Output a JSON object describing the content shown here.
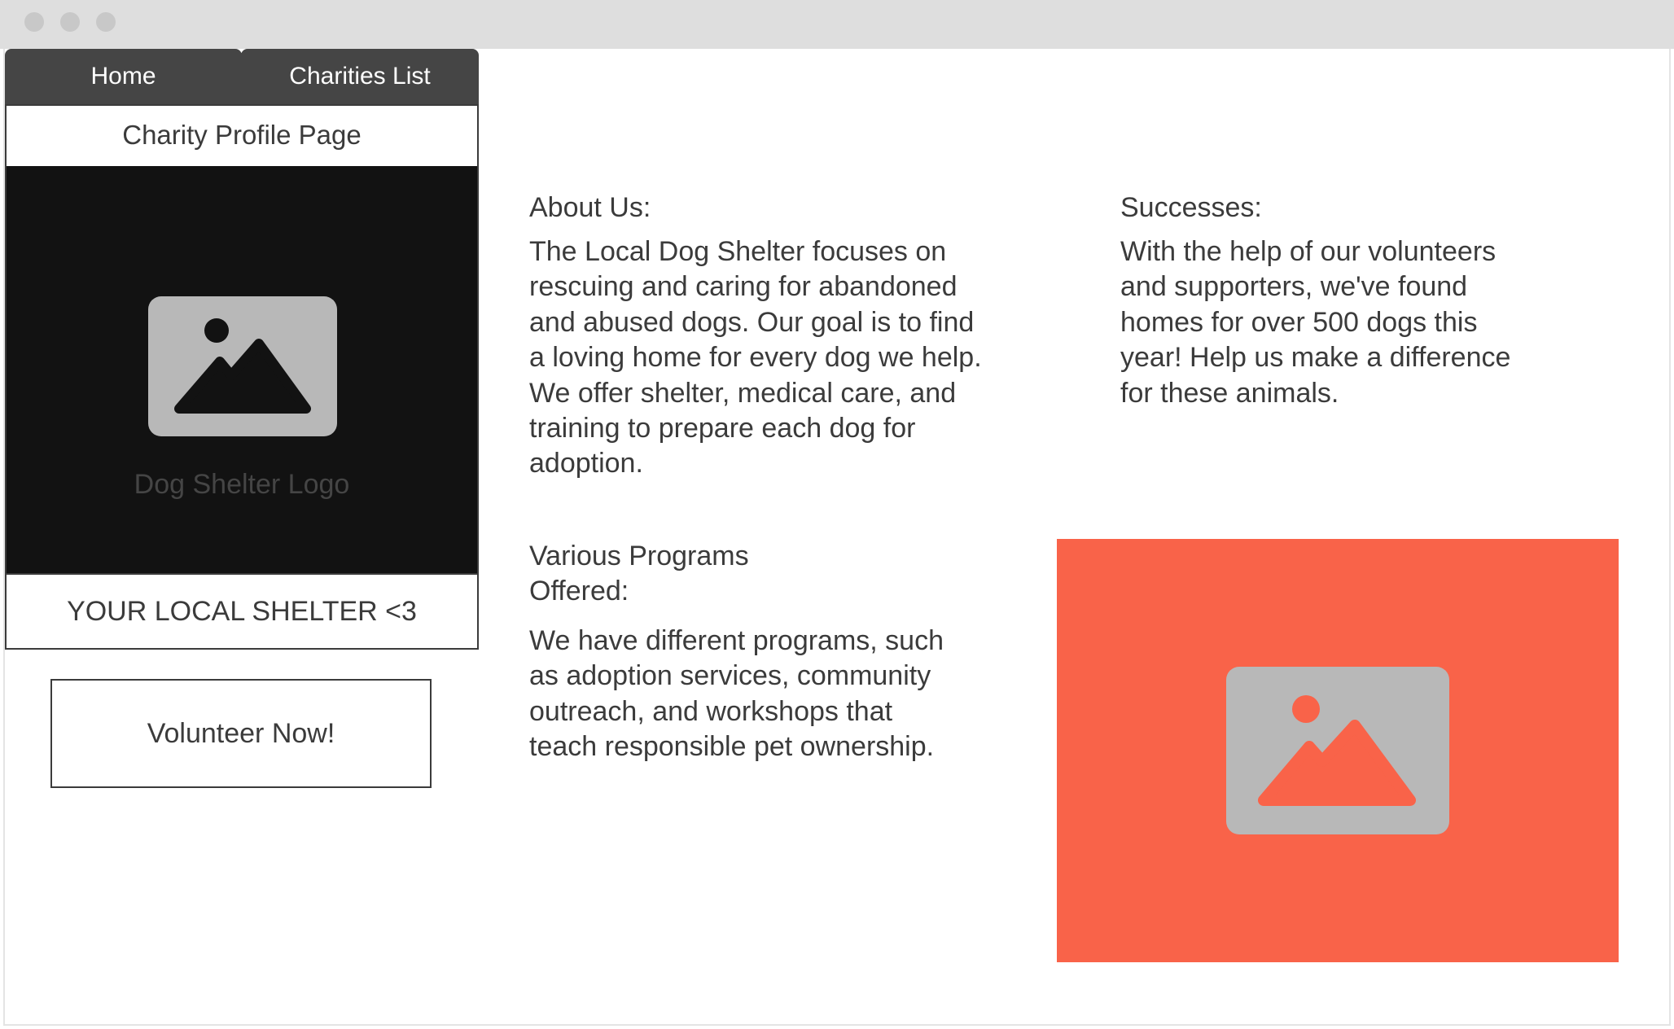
{
  "nav": {
    "tabs": [
      {
        "label": "Home"
      },
      {
        "label": "Charities List"
      }
    ]
  },
  "profile": {
    "page_title": "Charity Profile Page",
    "logo_caption": "Dog Shelter Logo",
    "shelter_name": "YOUR LOCAL SHELTER <3",
    "volunteer_label": "Volunteer Now!"
  },
  "about": {
    "heading": "About Us:",
    "text": "The Local Dog Shelter focuses on rescuing and caring for abandoned and abused dogs. Our goal is to find a loving home for every dog we help. We offer shelter, medical care, and training to prepare each dog for adoption."
  },
  "programs": {
    "heading": "Various Programs Offered:",
    "text": "We have different programs, such as adoption services, community outreach, and workshops that teach responsible pet ownership."
  },
  "successes": {
    "heading": "Successes:",
    "text": "With the help of our volunteers and supporters, we've found homes for over 500 dogs this year! Help us make a difference for these animals."
  },
  "icons": {
    "logo_placeholder": "image-placeholder-icon",
    "feature_placeholder": "image-placeholder-icon"
  },
  "colors": {
    "tab_background": "#454545",
    "logo_background": "#121212",
    "feature_background": "#f96349",
    "placeholder_gray": "#b8b8b8"
  }
}
